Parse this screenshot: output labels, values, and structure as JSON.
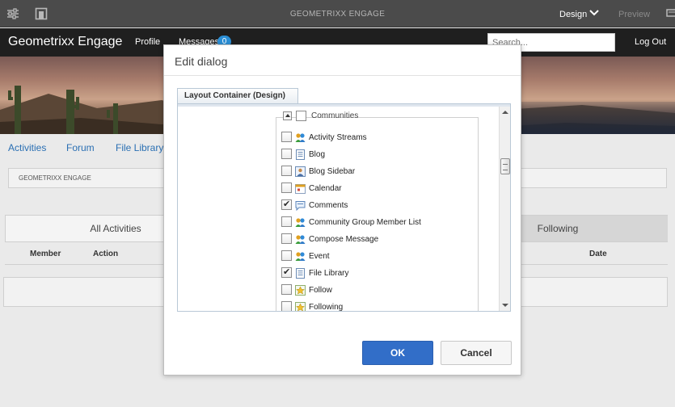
{
  "editor_bar": {
    "page_name": "GEOMETRIXX ENGAGE",
    "mode_label": "Design",
    "preview_label": "Preview",
    "icons": [
      "sliders-icon",
      "page-properties-icon",
      "chevron-down-icon",
      "annotate-icon"
    ]
  },
  "site_header": {
    "brand": "Geometrixx Engage",
    "nav": {
      "profile": "Profile",
      "messages": "Messages",
      "messages_count": "0"
    },
    "search_placeholder": "Search...",
    "logout": "Log Out"
  },
  "subnav": [
    "Activities",
    "Forum",
    "File Library"
  ],
  "breadcrumb": "GEOMETRIXX ENGAGE",
  "activity_tabs": {
    "all": "All Activities",
    "following": "Following"
  },
  "columns": {
    "member": "Member",
    "action": "Action",
    "date": "Date"
  },
  "dialog": {
    "title": "Edit dialog",
    "tab_label": "Layout Container (Design)",
    "group": {
      "label": "Communities",
      "checked": false
    },
    "items": [
      {
        "label": "Activity Streams",
        "checked": false,
        "icon": "community-people-icon"
      },
      {
        "label": "Blog",
        "checked": false,
        "icon": "document-list-icon"
      },
      {
        "label": "Blog Sidebar",
        "checked": false,
        "icon": "person-card-icon"
      },
      {
        "label": "Calendar",
        "checked": false,
        "icon": "calendar-icon"
      },
      {
        "label": "Comments",
        "checked": true,
        "icon": "comment-bubble-icon"
      },
      {
        "label": "Community Group Member List",
        "checked": false,
        "icon": "community-people-icon"
      },
      {
        "label": "Compose Message",
        "checked": false,
        "icon": "community-people-icon"
      },
      {
        "label": "Event",
        "checked": false,
        "icon": "community-people-icon"
      },
      {
        "label": "File Library",
        "checked": true,
        "icon": "document-list-icon"
      },
      {
        "label": "Follow",
        "checked": false,
        "icon": "star-badge-icon"
      },
      {
        "label": "Following",
        "checked": false,
        "icon": "star-badge-icon"
      }
    ],
    "ok_label": "OK",
    "cancel_label": "Cancel"
  },
  "colors": {
    "editor_bar": "#4b4b4b",
    "site_header": "#1f1f1f",
    "link": "#2a6fb3",
    "badge": "#2b8fd6",
    "primary_button": "#326ec8"
  }
}
